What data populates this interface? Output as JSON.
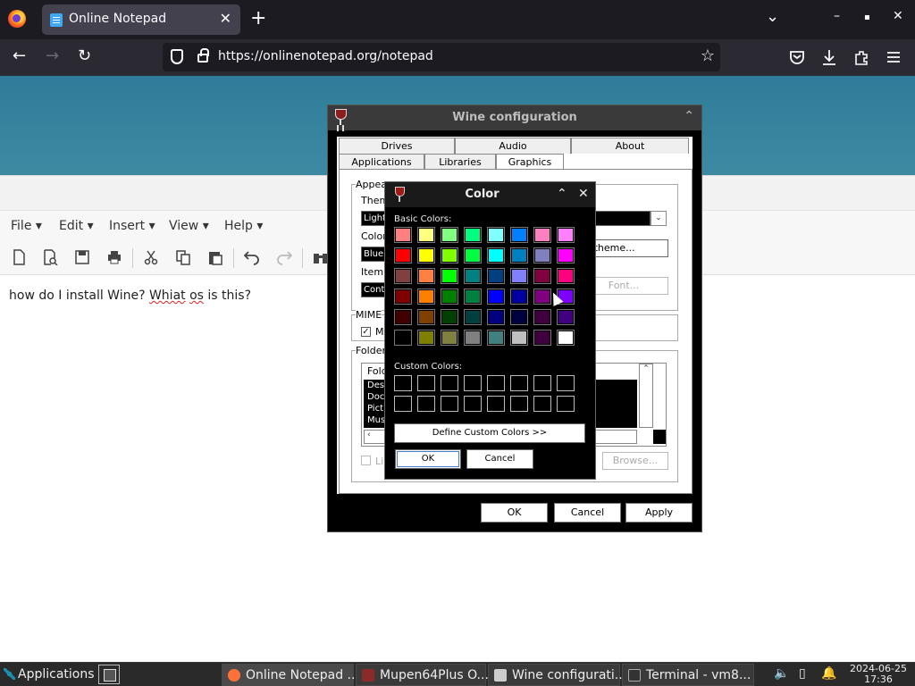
{
  "browser": {
    "tab_title": "Online Notepad",
    "tab_close": "✕",
    "new_tab": "+",
    "url": "https://onlinenotepad.org/notepad",
    "window_controls": {
      "list_all_tabs": "⌄",
      "minimize": "–",
      "maximize": "▪",
      "close": "✕"
    },
    "nav": {
      "back": "←",
      "forward": "→",
      "reload": "↻",
      "bookmark_star": "☆"
    },
    "toolbar_icons": [
      "pocket-icon",
      "download-icon",
      "extensions-icon",
      "menu-icon"
    ]
  },
  "notepad": {
    "menus": [
      "File",
      "Edit",
      "Insert",
      "View",
      "Help"
    ],
    "menu_caret": "▾",
    "toolbar_icons": [
      "new-document-icon",
      "open-preview-icon",
      "save-icon",
      "print-icon",
      "cut-icon",
      "copy-icon",
      "paste-icon",
      "undo-icon",
      "redo-icon",
      "find-icon"
    ],
    "text_before": "how do I install Wine? ",
    "text_misspelled": "Whiat",
    "text_mid": " ",
    "text_misspelled2": "os",
    "text_after": " is this?"
  },
  "wine_config": {
    "title": "Wine configuration",
    "tabs_row1": [
      "Drives",
      "Audio",
      "About"
    ],
    "tabs_row2": [
      "Applications",
      "Libraries",
      "Graphics"
    ],
    "appearance_label": "Appea",
    "theme_label": "Them",
    "theme_value": "Light",
    "color_label": "Color",
    "color_value": "Blue",
    "item_label": "Item:",
    "item_value": "Cont",
    "install_theme_button": "ll theme...",
    "font_button": "Font...",
    "mime_label": "MIME",
    "mime_check_label": "Ma",
    "mime_checked": "✓",
    "folders_label": "Folder",
    "folder_col": "Fold",
    "folder_rows": [
      "Des",
      "Doc",
      "Pict",
      "Mus"
    ],
    "link_check_label": "Li",
    "browse_button": "Browse...",
    "ok": "OK",
    "cancel": "Cancel",
    "apply": "Apply"
  },
  "color_dialog": {
    "title": "Color",
    "collapse": "⌃",
    "close": "✕",
    "basic_label": "Basic Colors:",
    "custom_label": "Custom Colors:",
    "define_button": "Define Custom Colors >>",
    "ok": "OK",
    "cancel": "Cancel",
    "basic_colors": [
      "#ff8080",
      "#ffff80",
      "#80ff80",
      "#00ff80",
      "#80ffff",
      "#0080ff",
      "#ff80c0",
      "#ff80ff",
      "#ff0000",
      "#ffff00",
      "#80ff00",
      "#00ff40",
      "#00ffff",
      "#0080c0",
      "#8080c0",
      "#ff00ff",
      "#804040",
      "#ff8040",
      "#00ff00",
      "#008080",
      "#004080",
      "#8080ff",
      "#800040",
      "#ff0080",
      "#800000",
      "#ff8000",
      "#008000",
      "#008040",
      "#0000ff",
      "#0000a0",
      "#800080",
      "#8000ff",
      "#400000",
      "#804000",
      "#004000",
      "#004040",
      "#000080",
      "#000040",
      "#400040",
      "#400080",
      "#000000",
      "#808000",
      "#808040",
      "#808080",
      "#408080",
      "#c0c0c0",
      "#400040",
      "#ffffff"
    ],
    "custom_colors_count_label": ""
  },
  "taskbar": {
    "applications": "Applications",
    "items": [
      {
        "label": "Online Notepad ...",
        "icon_color": "#ff7139"
      },
      {
        "label": "Mupen64Plus O...",
        "icon_color": "#8a2a2a"
      },
      {
        "label": "Wine configurati...",
        "icon_color": "#cccccc"
      },
      {
        "label": "Terminal - vm8...",
        "icon_color": "#333333"
      }
    ],
    "date": "2024-06-25",
    "time": "17:36"
  }
}
